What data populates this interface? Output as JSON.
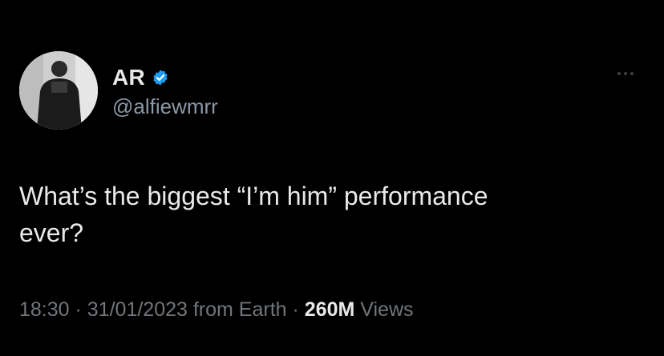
{
  "author": {
    "display_name": "AR",
    "handle": "@alfiewmrr",
    "verified": true,
    "avatar_icon": "profile-photo"
  },
  "menu_icon": "more-horizontal-icon",
  "tweet": {
    "text": "What’s the biggest “I’m him” performance\never?"
  },
  "meta": {
    "time": "18:30",
    "separator1": " · ",
    "date": "31/01/2023",
    "source": " from Earth",
    "separator2": " · ",
    "views_count": "260M",
    "views_label": " Views"
  },
  "colors": {
    "background": "#000000",
    "text_primary": "#e7e9ea",
    "text_secondary": "#71767b",
    "verified_blue": "#1d9bf0"
  }
}
